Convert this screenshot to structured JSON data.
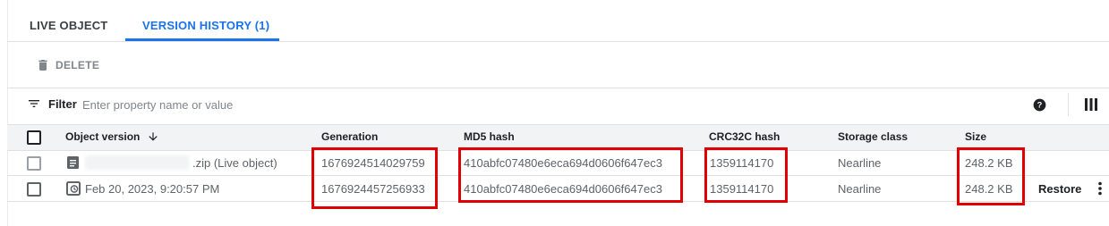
{
  "tabs": [
    {
      "label": "LIVE OBJECT",
      "active": false
    },
    {
      "label": "VERSION HISTORY (1)",
      "active": true
    }
  ],
  "toolbar": {
    "delete_label": "DELETE"
  },
  "filter": {
    "label": "Filter",
    "placeholder": "Enter property name or value"
  },
  "table": {
    "columns": [
      "Object version",
      "Generation",
      "MD5 hash",
      "CRC32C hash",
      "Storage class",
      "Size"
    ],
    "rows": [
      {
        "object_version": ".zip (Live object)",
        "generation": "1676924514029759",
        "md5": "410abfc07480e6eca694d0606f647ec3",
        "crc32c": "1359114170",
        "storage_class": "Nearline",
        "size": "248.2 KB",
        "action": ""
      },
      {
        "object_version": "Feb 20, 2023, 9:20:57 PM",
        "generation": "1676924457256933",
        "md5": "410abfc07480e6eca694d0606f647ec3",
        "crc32c": "1359114170",
        "storage_class": "Nearline",
        "size": "248.2 KB",
        "action": "Restore"
      }
    ]
  },
  "colors": {
    "accent": "#1a73e8",
    "highlight": "#e00000",
    "header_bg": "#f1f3f4"
  },
  "icons": [
    "trash-icon",
    "filter-icon",
    "help-icon",
    "column-display-icon",
    "arrow-down-icon",
    "file-icon",
    "history-icon",
    "more-vert-icon"
  ]
}
